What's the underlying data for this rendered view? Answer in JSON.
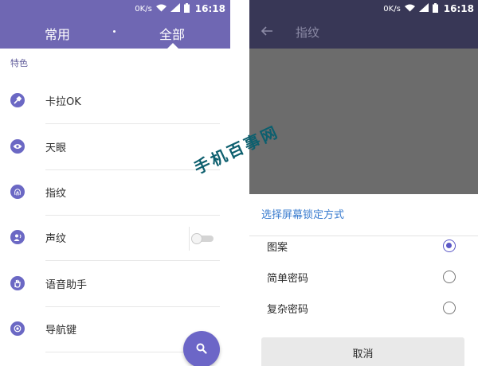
{
  "left_screen": {
    "status_bar": {
      "speed": "0K/s",
      "time": "16:18"
    },
    "tabs": [
      {
        "label": "常用",
        "active": false
      },
      {
        "label": "全部",
        "active": true
      }
    ],
    "section_title": "特色",
    "items": [
      {
        "label": "卡拉OK",
        "icon": "microphone-icon"
      },
      {
        "label": "天眼",
        "icon": "eye-icon"
      },
      {
        "label": "指纹",
        "icon": "fingerprint-icon"
      },
      {
        "label": "声纹",
        "icon": "voiceprint-icon",
        "toggle": false
      },
      {
        "label": "语音助手",
        "icon": "hand-icon"
      },
      {
        "label": "导航键",
        "icon": "nav-key-icon"
      }
    ],
    "fab_icon": "search-icon"
  },
  "right_screen": {
    "status_bar": {
      "speed": "0K/s",
      "time": "16:18"
    },
    "title": "指纹",
    "dialog": {
      "title": "选择屏幕锁定方式",
      "options": [
        {
          "label": "图案",
          "selected": true
        },
        {
          "label": "简单密码",
          "selected": false
        },
        {
          "label": "复杂密码",
          "selected": false
        }
      ],
      "cancel_label": "取消"
    }
  },
  "watermark": "手机百事网",
  "colors": {
    "header_left": "#6f67b3",
    "header_right": "#383756",
    "accent": "#5b58c6",
    "dialog_title": "#3a7ccf"
  }
}
